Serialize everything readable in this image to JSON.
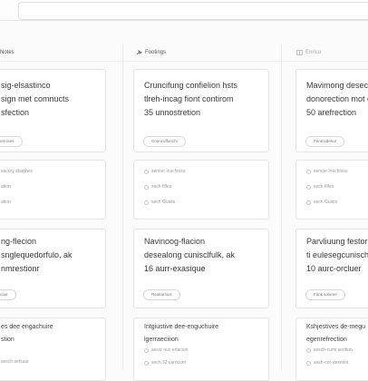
{
  "columns": [
    {
      "label": "Notes"
    },
    {
      "label": "Footings"
    },
    {
      "label": "Enricu"
    }
  ],
  "cards": {
    "c1": {
      "title": "sig-elsastinco\nsign met comnucts\nsfection",
      "pill": "Exercises"
    },
    "c2": {
      "title": "Cruncifung confielion hsts\ntlreh-incag fiont contirom\n35 unnostretion",
      "pill": "Conncuffunchi"
    },
    "c3": {
      "title": "Mavimong desectio\ndonorection mot c\n50 arefrection",
      "pill": "Fenit udenur"
    },
    "c4": {
      "meta": [
        "sacory sbaghes",
        "ation",
        "ation"
      ]
    },
    "c5": {
      "meta": [
        "sencer Inschnisu",
        "sech filfes",
        "sech Guicts"
      ]
    },
    "c6": {
      "meta": [
        "sencer Inschnisu",
        "sech filfes",
        "sech Guicts"
      ]
    },
    "c7": {
      "title": "ng-flecion\nsnglequedorfulo, ak\nnmrestionr",
      "pill": "Elcaut"
    },
    "c8": {
      "title": "Navinoog-flacion\ndesealong cunisclfulk, ak\n16 aurr-exasique",
      "pill": "Reintarnius"
    },
    "c9": {
      "title": "Parvliuung festor\nti eulesegcunisch\n10 aurc-orcluer",
      "pill": "Fank solvore"
    },
    "c10": {
      "title": "es dee engachuire\nstion",
      "meta": [
        "sesch sefsuur"
      ]
    },
    "c11": {
      "title": "Intgiustive dee-enguchuire\nlgerraeciiion",
      "meta": [
        "sescr nuc ertacion",
        "sech 32 carncom"
      ]
    },
    "c12": {
      "title": "Kshjestives de-megu\negenrefrection",
      "meta": [
        "sesch-cumi serition",
        "sesh-cor-dexmlot"
      ]
    }
  }
}
